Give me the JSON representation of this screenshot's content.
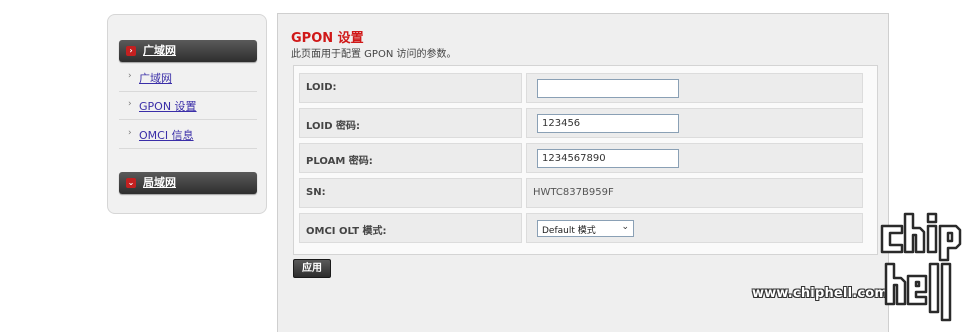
{
  "sidebar": {
    "groups": [
      {
        "title": "广域网",
        "badge": "›",
        "items": [
          {
            "label": "广域网"
          },
          {
            "label": "GPON 设置"
          },
          {
            "label": "OMCI 信息"
          }
        ]
      },
      {
        "title": "局域网",
        "badge": "⌄",
        "items": []
      }
    ]
  },
  "page": {
    "title": "GPON 设置",
    "description": "此页面用于配置 GPON 访问的参数。"
  },
  "form": {
    "loid": {
      "label": "LOID:",
      "value": ""
    },
    "loid_password": {
      "label": "LOID 密码:",
      "value": "123456"
    },
    "ploam_password": {
      "label": "PLOAM 密码:",
      "value": "1234567890"
    },
    "sn": {
      "label": "SN:",
      "value": "HWTC837B959F"
    },
    "omci_olt_mode": {
      "label": "OMCI OLT 模式:",
      "selected": "Default 模式"
    }
  },
  "buttons": {
    "apply": "应用"
  },
  "watermark": {
    "site": "www.chiphell.com",
    "logo_text": "chiphell"
  },
  "colors": {
    "title_red": "#d01818",
    "link_blue": "#3a2ea8",
    "badge_red": "#c42020"
  }
}
